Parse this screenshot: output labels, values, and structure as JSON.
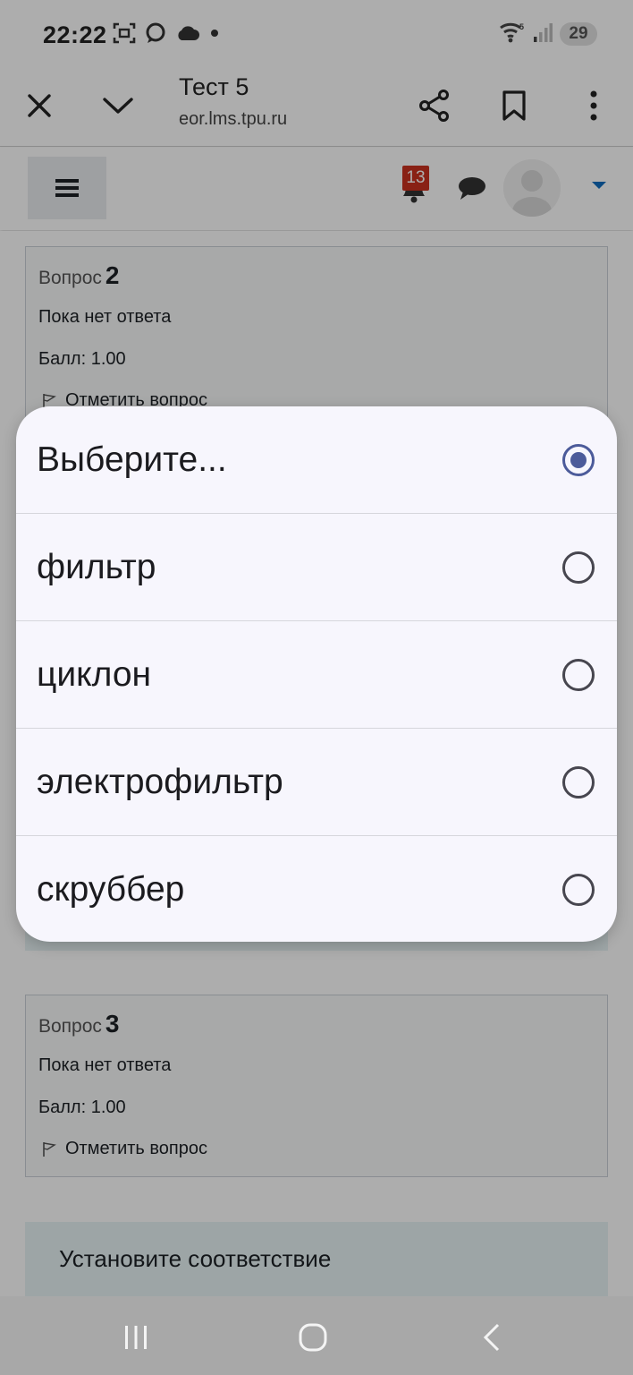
{
  "status_bar": {
    "time": "22:22",
    "battery": "29",
    "icons": [
      "screenshot-icon",
      "messenger-icon",
      "cloud-icon",
      "dot-icon",
      "wifi-icon",
      "signal-icon",
      "battery-icon"
    ]
  },
  "browser": {
    "title": "Тест 5",
    "url": "eor.lms.tpu.ru"
  },
  "navbar": {
    "notification_count": "13"
  },
  "questions": [
    {
      "label": "Вопрос",
      "number": "2",
      "state": "Пока нет ответа",
      "grade": "Балл: 1.00",
      "flag": "Отметить вопрос"
    },
    {
      "label": "Вопрос",
      "number": "3",
      "state": "Пока нет ответа",
      "grade": "Балл: 1.00",
      "flag": "Отметить вопрос"
    }
  ],
  "formulation_text": "Установите соответствие",
  "picker": {
    "selected_index": 0,
    "options": [
      "Выберите...",
      "фильтр",
      "циклон",
      "электрофильтр",
      "скруббер"
    ]
  },
  "colors": {
    "accent": "#4c5b9a",
    "badge": "#ca3120",
    "link": "#0f6cbf"
  }
}
